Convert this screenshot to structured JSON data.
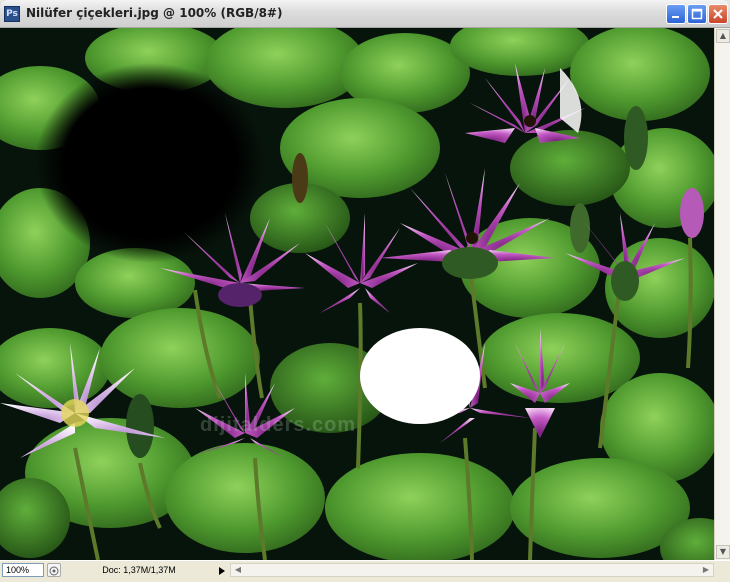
{
  "window": {
    "app_icon_text": "Ps",
    "title": "Nilüfer çiçekleri.jpg @ 100% (RGB/8#)",
    "minimize_glyph": "_",
    "maximize_glyph": "□",
    "close_glyph": "×"
  },
  "canvas": {
    "watermark": "dijitalders.com",
    "description_colors": {
      "leaf": "#4f9a2f",
      "leaf_light": "#7cc24a",
      "petal": "#c55bc6",
      "petal_light": "#f0d2f0",
      "water": "#07140b"
    }
  },
  "statusbar": {
    "zoom": "100%",
    "doc_info": "Doc: 1,37M/1,37M"
  },
  "icons": [
    "app-icon",
    "minimize-icon",
    "maximize-icon",
    "close-icon",
    "navigator-icon",
    "menu-arrow-icon",
    "scroll-up-icon",
    "scroll-down-icon",
    "scroll-left-icon",
    "scroll-right-icon"
  ]
}
